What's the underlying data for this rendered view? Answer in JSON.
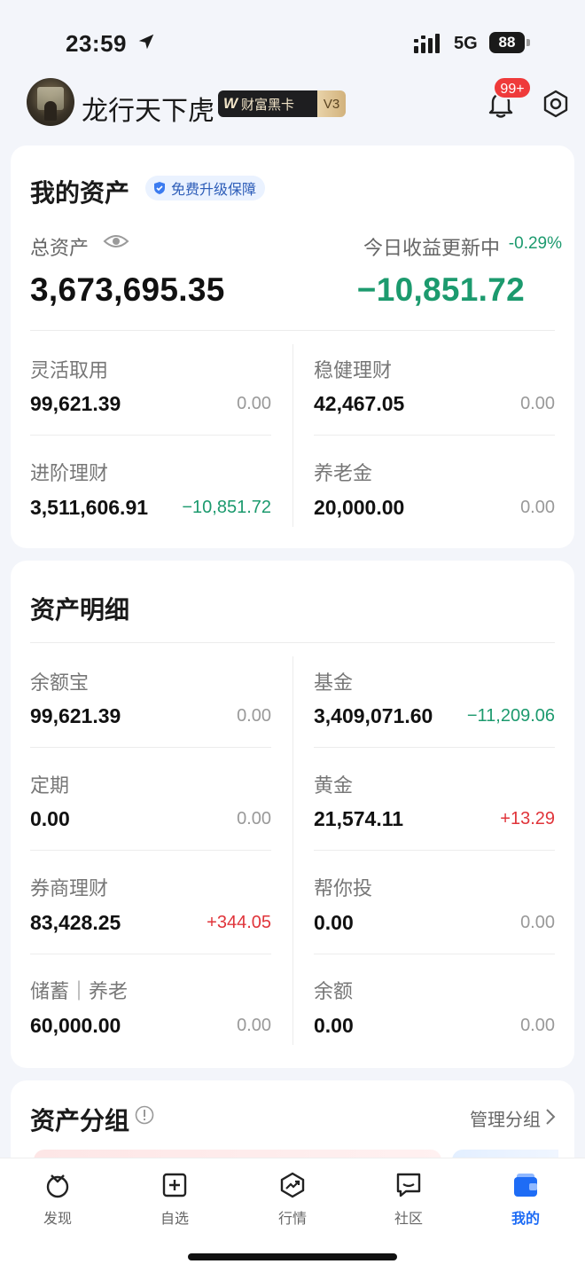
{
  "status_bar": {
    "time": "23:59",
    "network": "5G",
    "battery": "88"
  },
  "profile": {
    "username": "龙行天下虎",
    "card_name": "财富黑卡",
    "card_level": "V3",
    "notification_count": "99+"
  },
  "my_assets": {
    "title": "我的资产",
    "guarantee_label": "免费升级保障",
    "total_label": "总资产",
    "total_value": "3,673,695.35",
    "today_label": "今日收益更新中",
    "today_pct": "-0.29%",
    "today_value": "−10,851.72",
    "items": [
      {
        "label": "灵活取用",
        "value": "99,621.39",
        "change": "0.00",
        "trend": "flat"
      },
      {
        "label": "稳健理财",
        "value": "42,467.05",
        "change": "0.00",
        "trend": "flat"
      },
      {
        "label": "进阶理财",
        "value": "3,511,606.91",
        "change": "−10,851.72",
        "trend": "down"
      },
      {
        "label": "养老金",
        "value": "20,000.00",
        "change": "0.00",
        "trend": "flat"
      }
    ]
  },
  "asset_detail": {
    "title": "资产明细",
    "items": [
      {
        "label": "余额宝",
        "value": "99,621.39",
        "change": "0.00",
        "trend": "flat"
      },
      {
        "label": "基金",
        "value": "3,409,071.60",
        "change": "−11,209.06",
        "trend": "down"
      },
      {
        "label": "定期",
        "value": "0.00",
        "change": "0.00",
        "trend": "flat"
      },
      {
        "label": "黄金",
        "value": "21,574.11",
        "change": "+13.29",
        "trend": "up"
      },
      {
        "label": "券商理财",
        "value": "83,428.25",
        "change": "+344.05",
        "trend": "up"
      },
      {
        "label": "帮你投",
        "value": "0.00",
        "change": "0.00",
        "trend": "flat"
      },
      {
        "label": "储蓄｜养老",
        "value": "60,000.00",
        "change": "0.00",
        "trend": "flat"
      },
      {
        "label": "余额",
        "value": "0.00",
        "change": "0.00",
        "trend": "flat"
      }
    ]
  },
  "asset_group": {
    "title": "资产分组",
    "manage_label": "管理分组"
  },
  "tabs": [
    {
      "label": "发现",
      "icon": "discover-icon"
    },
    {
      "label": "自选",
      "icon": "watchlist-icon"
    },
    {
      "label": "行情",
      "icon": "market-icon"
    },
    {
      "label": "社区",
      "icon": "community-icon"
    },
    {
      "label": "我的",
      "icon": "wallet-icon",
      "active": true
    }
  ],
  "colors": {
    "accent": "#1e6cf5",
    "down": "#1c9a6e",
    "up": "#e0343a",
    "badge": "#ef3a3a"
  }
}
